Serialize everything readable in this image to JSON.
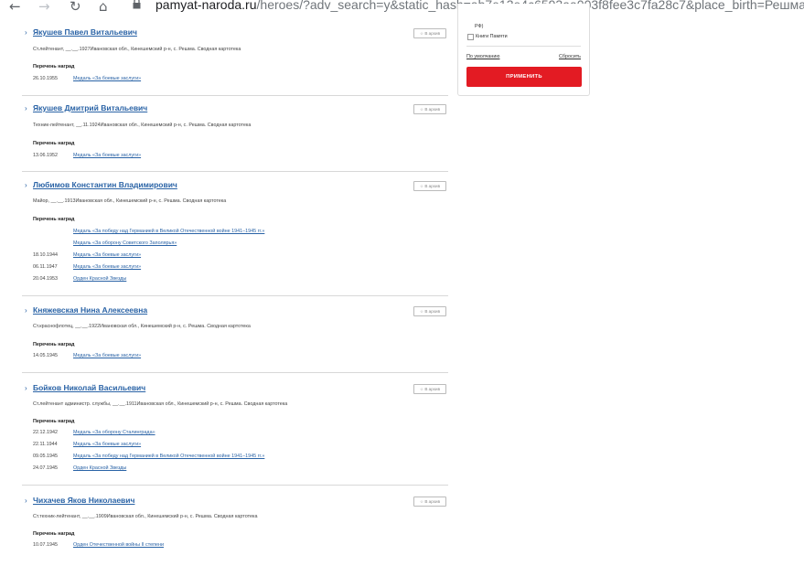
{
  "browser": {
    "url_host": "pamyat-naroda.ru",
    "url_path": "/heroes/?adv_search=y&static_hash=ab7e13e4c6593aa003f8fee3c7fa28c7&place_birth=Решма&"
  },
  "filter_panel": {
    "partial_line": "РФ)",
    "checkbox_label": "Книги Памяти",
    "default_link": "По умолчанию",
    "reset_link": "Сбросить",
    "apply_button": "ПРИМЕНИТЬ"
  },
  "results": [
    {
      "name": "Якушев Павел Витальевич",
      "fav": "В архив",
      "desc": "Ст.лейтенант, __.__.1927Ивановская обл., Кинешемский р-н, с. Решма. Сводная картотека",
      "awards_header": "Перечень наград",
      "awards": [
        {
          "date": "26.10.1955",
          "medal": "Медаль «За боевые заслуги»"
        }
      ]
    },
    {
      "name": "Якушев Дмитрий Витальевич",
      "fav": "В архив",
      "desc": "Техник-лейтенант, __.11.1924Ивановская обл., Кинешемский р-н, с. Решма. Сводная картотека",
      "awards_header": "Перечень наград",
      "awards": [
        {
          "date": "13.06.1952",
          "medal": "Медаль «За боевые заслуги»"
        }
      ]
    },
    {
      "name": "Любимов Константин Владимирович",
      "fav": "В архив",
      "desc": "Майор, __.__.1913Ивановская обл., Кинешемский р-н, с. Решма. Сводная картотека",
      "awards_header": "Перечень наград",
      "awards": [
        {
          "date": "",
          "medal": "Медаль «За победу над Германией в Великой Отечественной войне 1941–1945 гг.»"
        },
        {
          "date": "",
          "medal": "Медаль «За оборону Советского Заполярья»"
        },
        {
          "date": "18.10.1944",
          "medal": "Медаль «За боевые заслуги»"
        },
        {
          "date": "06.11.1947",
          "medal": "Медаль «За боевые заслуги»"
        },
        {
          "date": "20.04.1953",
          "medal": "Орден Красной Звезды"
        }
      ]
    },
    {
      "name": "Княжевская Нина Алексеевна",
      "fav": "В архив",
      "desc": "Ст.краснофлотец, __.__.1922Ивановская обл., Кинешемский р-н, с. Решма. Сводная картотека",
      "awards_header": "Перечень наград",
      "awards": [
        {
          "date": "14.05.1945",
          "medal": "Медаль «За боевые заслуги»"
        }
      ]
    },
    {
      "name": "Бойков Николай Васильевич",
      "fav": "В архив",
      "desc": "Ст.лейтенант администр. службы, __.__.1911Ивановская обл., Кинешемский р-н, с. Решма. Сводная картотека",
      "awards_header": "Перечень наград",
      "awards": [
        {
          "date": "22.12.1942",
          "medal": "Медаль «За оборону Сталинграда»"
        },
        {
          "date": "22.11.1944",
          "medal": "Медаль «За боевые заслуги»"
        },
        {
          "date": "09.05.1945",
          "medal": "Медаль «За победу над Германией в Великой Отечественной войне 1941–1945 гг.»"
        },
        {
          "date": "24.07.1945",
          "medal": "Орден Красной Звезды"
        }
      ]
    },
    {
      "name": "Чихачев Яков Николаевич",
      "fav": "В архив",
      "desc": "Ст.техник-лейтенант, __.__.1909Ивановская обл., Кинешемский р-н, с. Решма. Сводная картотека",
      "awards_header": "Перечень наград",
      "awards": [
        {
          "date": "10.07.1945",
          "medal": "Орден Отечественной войны II степени"
        }
      ]
    }
  ],
  "icons": {
    "back": "back-arrow-icon",
    "forward": "forward-arrow-icon",
    "reload": "reload-icon",
    "home": "home-icon",
    "lock": "lock-icon",
    "star": "star-icon",
    "chevron": "chevron-right-icon"
  }
}
